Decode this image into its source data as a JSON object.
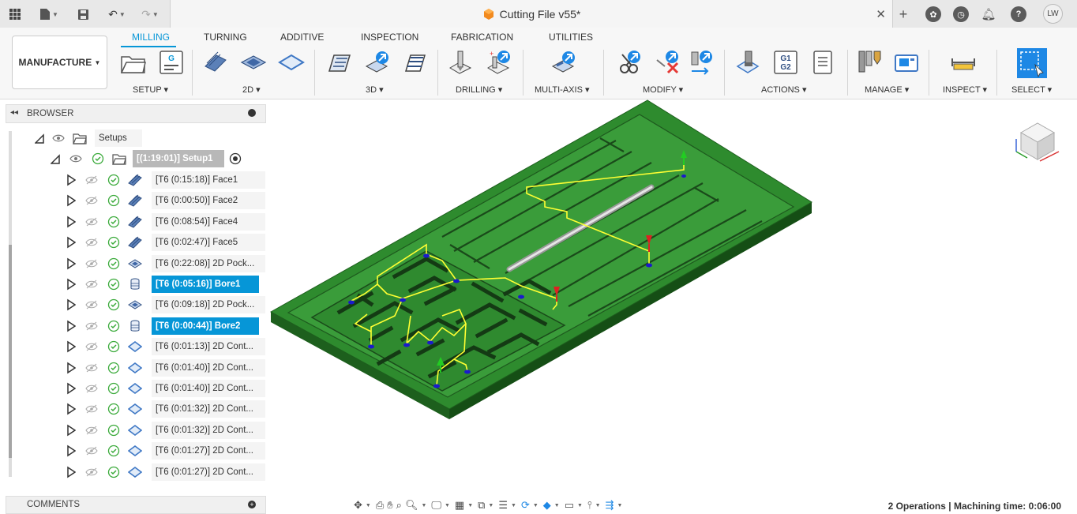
{
  "app": {
    "document_title": "Cutting File v55*",
    "avatar_initials": "LW",
    "status_text": "2 Operations | Machining time: 0:06:00"
  },
  "ribbon": {
    "workspace_label": "MANUFACTURE",
    "tabs": [
      "MILLING",
      "TURNING",
      "ADDITIVE",
      "INSPECTION",
      "FABRICATION",
      "UTILITIES"
    ],
    "active_tab": "MILLING",
    "groups": [
      "SETUP",
      "2D",
      "3D",
      "DRILLING",
      "MULTI-AXIS",
      "MODIFY",
      "ACTIONS",
      "MANAGE",
      "INSPECT",
      "SELECT"
    ],
    "nc_icon_text": "G1 G2",
    "setup_icon_text": "G"
  },
  "browser": {
    "title": "BROWSER",
    "setups_label": "Setups",
    "setup_label": "[(1:19:01)] Setup1",
    "operations": [
      {
        "label": "[T6 (0:15:18)] Face1",
        "icon": "face-icon",
        "selected": false
      },
      {
        "label": "[T6 (0:00:50)] Face2",
        "icon": "face-icon",
        "selected": false
      },
      {
        "label": "[T6 (0:08:54)] Face4",
        "icon": "face-icon",
        "selected": false
      },
      {
        "label": "[T6 (0:02:47)] Face5",
        "icon": "face-icon",
        "selected": false
      },
      {
        "label": "[T6 (0:22:08)] 2D Pock...",
        "icon": "pocket-icon",
        "selected": false
      },
      {
        "label": "[T6 (0:05:16)] Bore1",
        "icon": "bore-icon",
        "selected": true
      },
      {
        "label": "[T6 (0:09:18)] 2D Pock...",
        "icon": "pocket-icon",
        "selected": false
      },
      {
        "label": "[T6 (0:00:44)] Bore2",
        "icon": "bore-icon",
        "selected": true
      },
      {
        "label": "[T6 (0:01:13)] 2D Cont...",
        "icon": "contour-icon",
        "selected": false
      },
      {
        "label": "[T6 (0:01:40)] 2D Cont...",
        "icon": "contour-icon",
        "selected": false
      },
      {
        "label": "[T6 (0:01:40)] 2D Cont...",
        "icon": "contour-icon",
        "selected": false
      },
      {
        "label": "[T6 (0:01:32)] 2D Cont...",
        "icon": "contour-icon",
        "selected": false
      },
      {
        "label": "[T6 (0:01:32)] 2D Cont...",
        "icon": "contour-icon",
        "selected": false
      },
      {
        "label": "[T6 (0:01:27)] 2D Cont...",
        "icon": "contour-icon",
        "selected": false
      },
      {
        "label": "[T6 (0:01:27)] 2D Cont...",
        "icon": "contour-icon",
        "selected": false
      }
    ]
  },
  "comments": {
    "title": "COMMENTS"
  },
  "colors": {
    "accent": "#0696d7",
    "part_green": "#2e8b2e",
    "toolpath_yellow": "#ffff33",
    "start_marker": "#22cc22",
    "end_marker": "#dd2222",
    "plunge_blue": "#1a1acc"
  }
}
